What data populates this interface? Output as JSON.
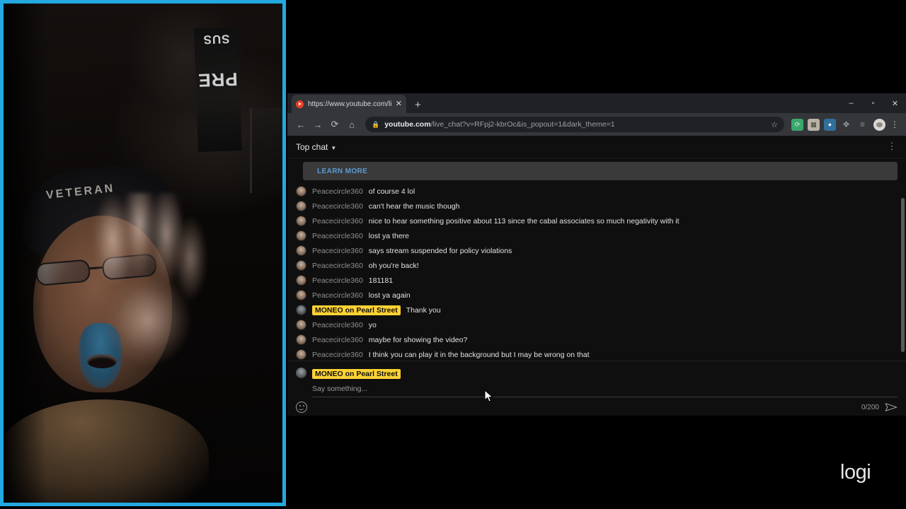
{
  "webcam": {
    "border_color": "#23a8e0",
    "cap_text": "VETERAN",
    "banner_line_1": "SUS",
    "banner_line_2": "PRE"
  },
  "browser": {
    "tab": {
      "title": "https://www.youtube.com/live_c",
      "favicon": "youtube-icon",
      "close_label": "✕",
      "new_tab_label": "+"
    },
    "window_controls": {
      "minimize": "–",
      "maximize": "▫",
      "close": "✕"
    },
    "toolbar": {
      "back": "←",
      "forward": "→",
      "reload": "⟳",
      "home": "⌂",
      "lock": "ὑ2",
      "url_host": "youtube.com",
      "url_path": "/live_chat?v=RFpj2-kbrOc&is_popout=1&dark_theme=1",
      "star": "☆",
      "menu": "⋮",
      "extensions": [
        {
          "name": "sync-extension-icon",
          "color": "#3aa76d",
          "glyph": "⟳"
        },
        {
          "name": "grid-extension-icon",
          "color": "#b9b3a5",
          "glyph": "☰"
        },
        {
          "name": "blue-extension-icon",
          "color": "#2f6f9e",
          "glyph": "●"
        },
        {
          "name": "puzzle-extensions-icon",
          "color": "#8d8f94",
          "glyph": "❖"
        },
        {
          "name": "reading-list-icon",
          "color": "#8d8f94",
          "glyph": "≡"
        }
      ]
    }
  },
  "chat": {
    "mode_label": "Top chat",
    "mode_caret": "▼",
    "overflow_menu": "⋮",
    "notice_link": "LEARN MORE",
    "messages": [
      {
        "author": "Peacecircle360",
        "text": "of course 4 lol",
        "owner": false
      },
      {
        "author": "Peacecircle360",
        "text": "can't hear the music though",
        "owner": false
      },
      {
        "author": "Peacecircle360",
        "text": "nice to hear something positive about 113 since the cabal associates so much negativity with it",
        "owner": false
      },
      {
        "author": "Peacecircle360",
        "text": "lost ya there",
        "owner": false
      },
      {
        "author": "Peacecircle360",
        "text": "says stream suspended for policy violations",
        "owner": false
      },
      {
        "author": "Peacecircle360",
        "text": "oh you're back!",
        "owner": false
      },
      {
        "author": "Peacecircle360",
        "text": "181181",
        "owner": false
      },
      {
        "author": "Peacecircle360",
        "text": "lost ya again",
        "owner": false
      },
      {
        "author": "MONEO on Pearl Street",
        "text": "Thank you",
        "owner": true
      },
      {
        "author": "Peacecircle360",
        "text": "yo",
        "owner": false
      },
      {
        "author": "Peacecircle360",
        "text": "maybe for showing the video?",
        "owner": false
      },
      {
        "author": "Peacecircle360",
        "text": "I think you can play it in the background but I may be wrong on that",
        "owner": false
      }
    ],
    "composer": {
      "author": "MONEO on Pearl Street",
      "placeholder": "Say something...",
      "char_count": "0/200",
      "emoji_label": "emoji-picker",
      "send_label": "send"
    }
  },
  "watermark": {
    "text": "logi"
  }
}
